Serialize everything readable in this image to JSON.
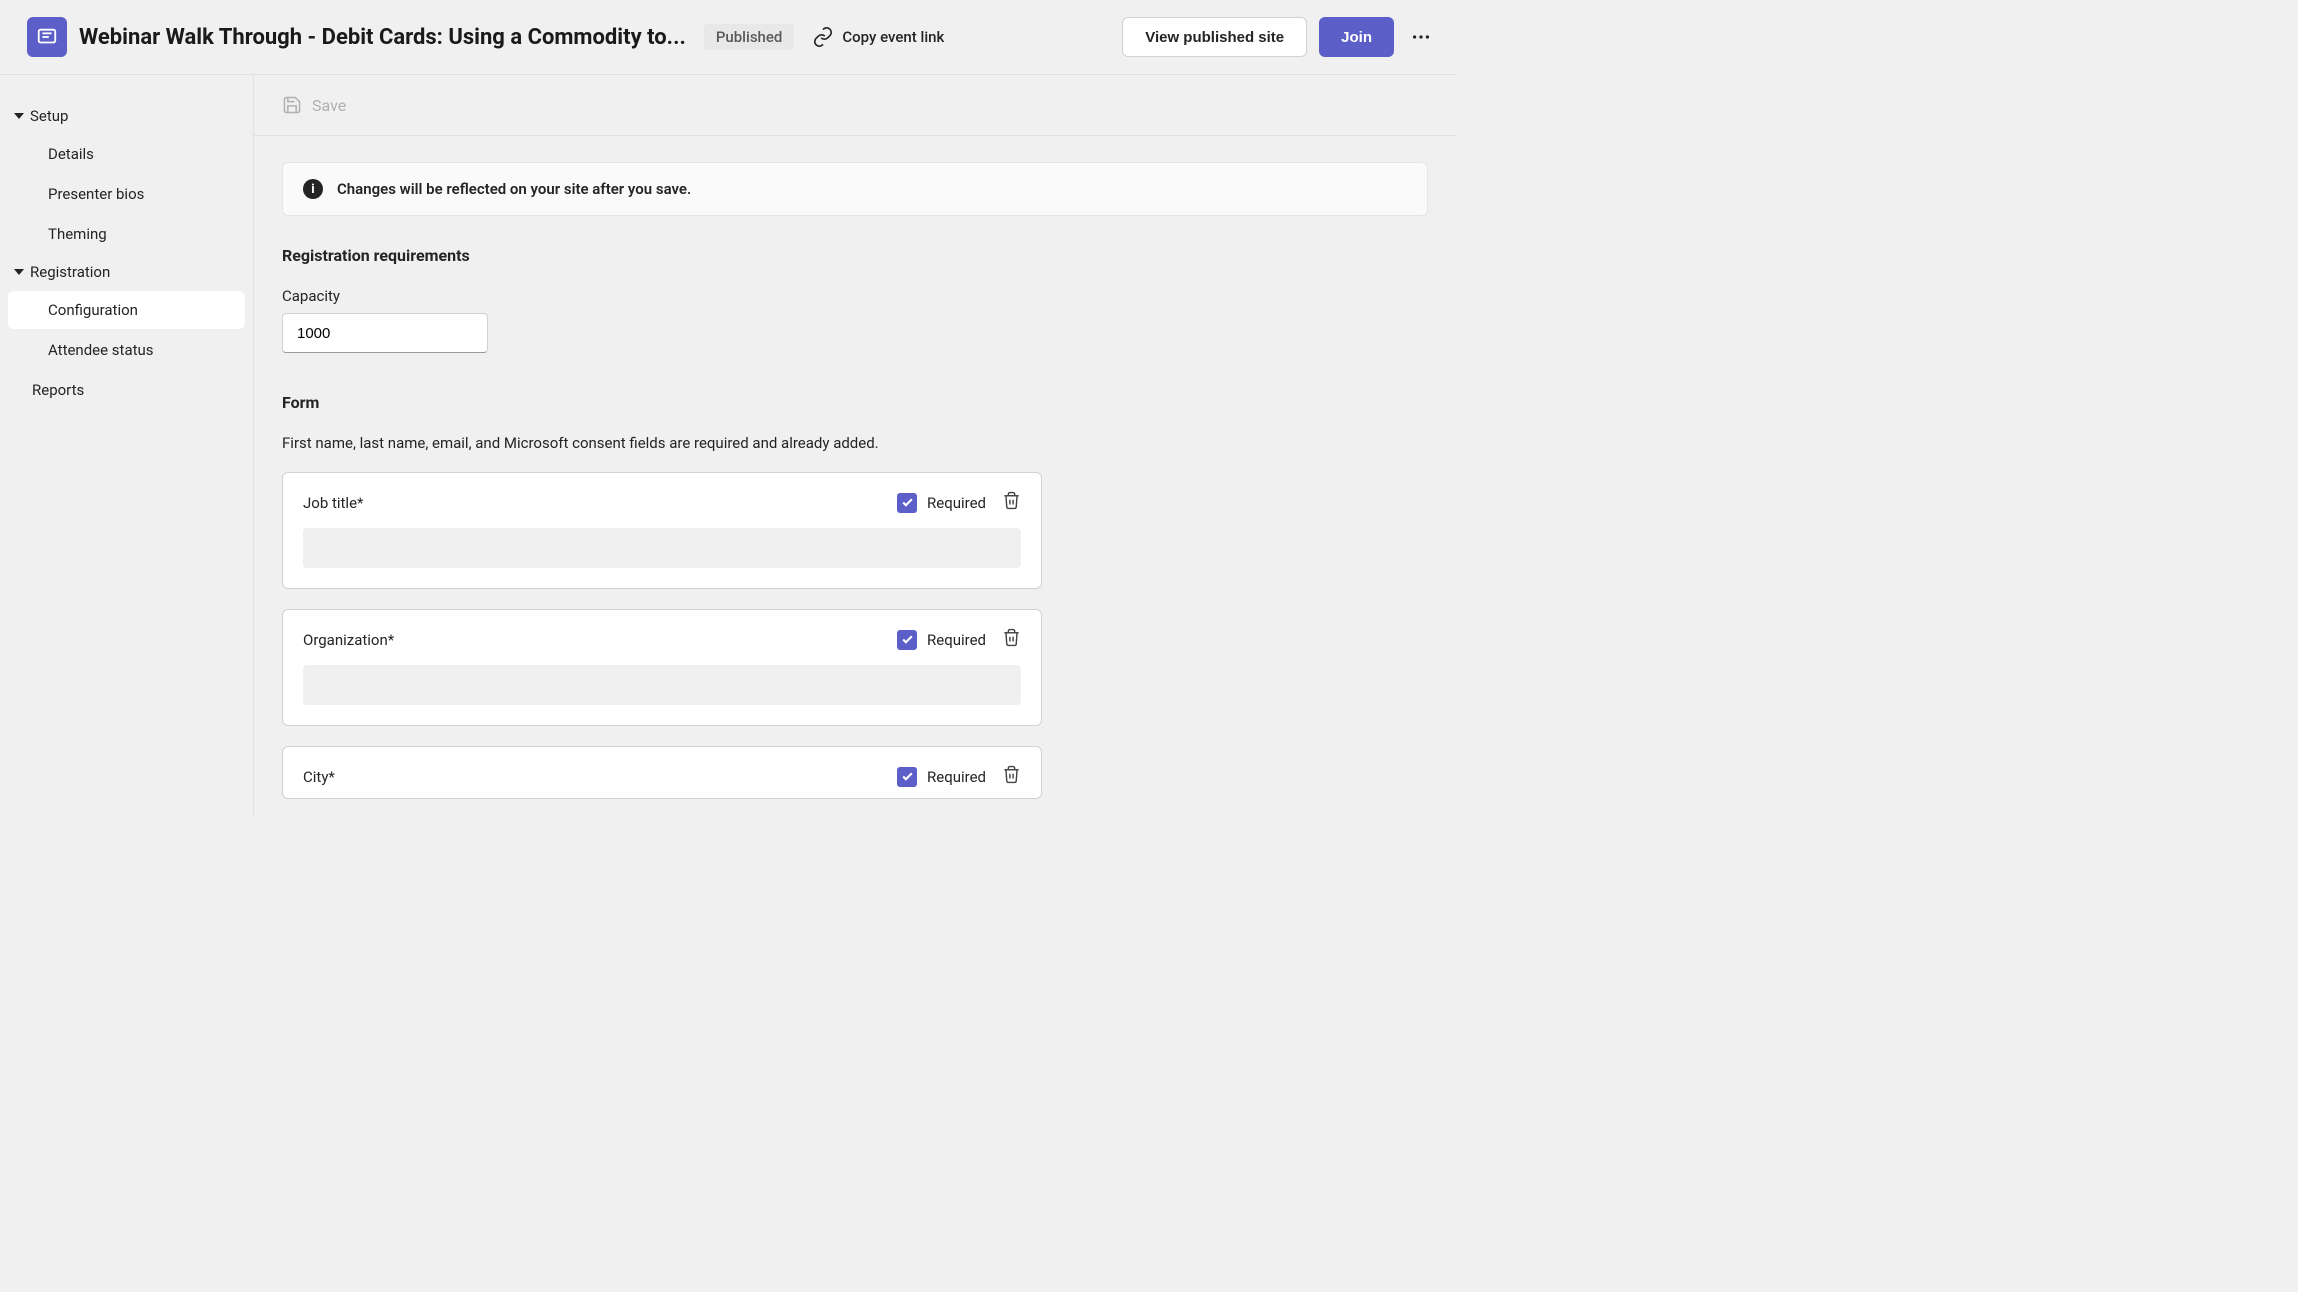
{
  "header": {
    "title": "Webinar Walk Through - Debit Cards: Using a Commodity to...",
    "status": "Published",
    "copy_link": "Copy event link",
    "view_site": "View published site",
    "join": "Join"
  },
  "sidebar": {
    "setup_label": "Setup",
    "setup_items": [
      "Details",
      "Presenter bios",
      "Theming"
    ],
    "registration_label": "Registration",
    "registration_items": [
      "Configuration",
      "Attendee status"
    ],
    "reports_label": "Reports"
  },
  "save_label": "Save",
  "info_banner": "Changes will be reflected on your site after you save.",
  "reg_req_title": "Registration requirements",
  "capacity_label": "Capacity",
  "capacity_value": "1000",
  "form_title": "Form",
  "form_desc": "First name, last name, email, and Microsoft consent fields are required and already added.",
  "required_label": "Required",
  "fields": [
    {
      "label": "Job title*",
      "required": true
    },
    {
      "label": "Organization*",
      "required": true
    },
    {
      "label": "City*",
      "required": true
    }
  ]
}
